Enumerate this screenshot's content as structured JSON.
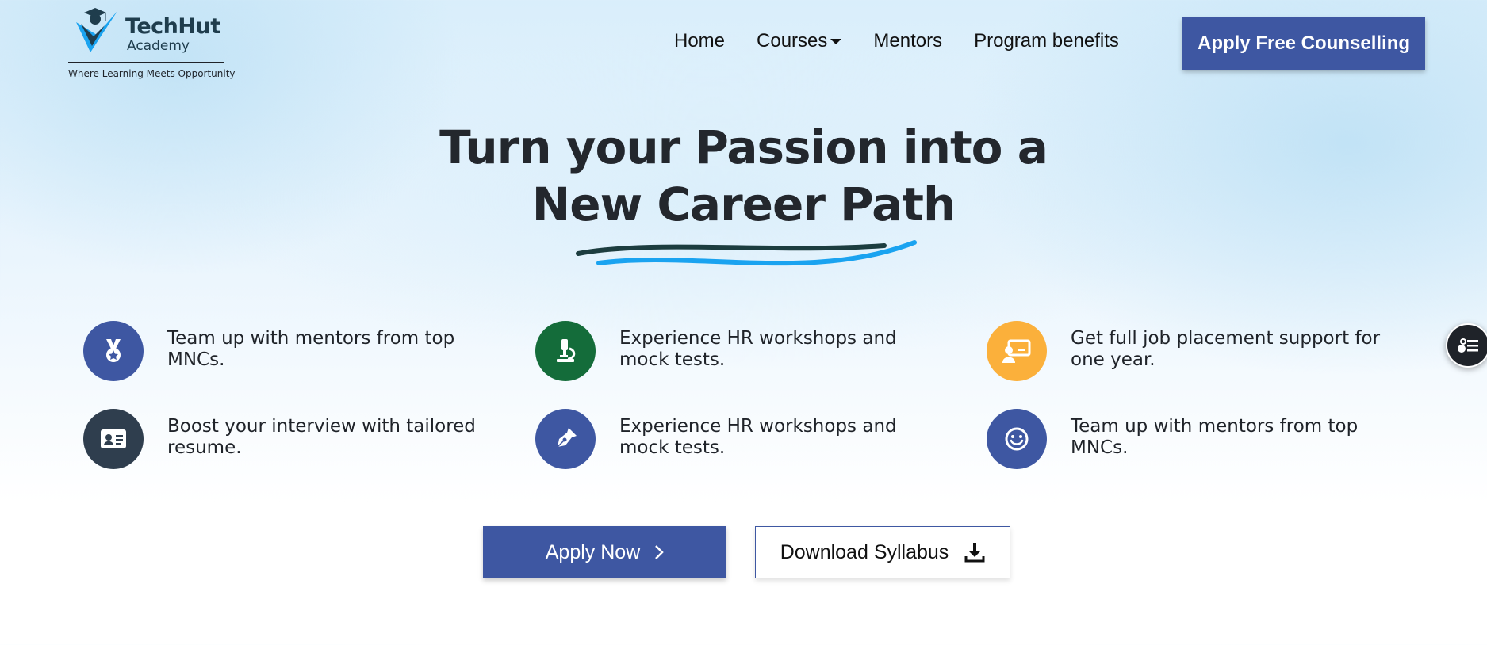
{
  "brand": {
    "name": "TechHut",
    "sub": "Academy",
    "tagline": "Where Learning Meets Opportunity"
  },
  "nav": {
    "items": [
      {
        "label": "Home"
      },
      {
        "label": "Courses"
      },
      {
        "label": "Mentors"
      },
      {
        "label": "Program benefits"
      }
    ],
    "cta": "Apply Free Counselling"
  },
  "hero": {
    "title_line1": "Turn your Passion into a",
    "title_line2": "New Career Path"
  },
  "features": [
    {
      "text": "Team up with mentors from top MNCs.",
      "icon": "medal-icon",
      "color": "#3e57a2"
    },
    {
      "text": "Experience HR workshops and mock tests.",
      "icon": "microscope-icon",
      "color": "#146c3a"
    },
    {
      "text": "Get full job placement support for one year.",
      "icon": "presentation-icon",
      "color": "#fbb03b"
    },
    {
      "text": "Boost your interview with tailored resume.",
      "icon": "id-card-icon",
      "color": "#2f3e4e"
    },
    {
      "text": "Experience HR workshops and mock tests.",
      "icon": "pen-nib-icon",
      "color": "#3e57a2"
    },
    {
      "text": "Team up with mentors from top MNCs.",
      "icon": "smile-icon",
      "color": "#3e57a2"
    }
  ],
  "actions": {
    "apply": "Apply Now",
    "download": "Download Syllabus"
  },
  "colors": {
    "primary": "#3e57a2",
    "swoosh_dark": "#1c3d3f",
    "swoosh_blue": "#1aa3f0"
  }
}
